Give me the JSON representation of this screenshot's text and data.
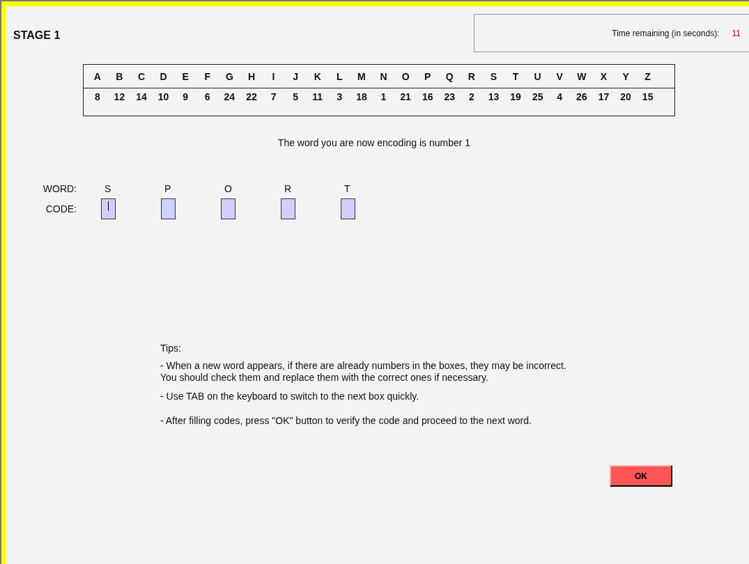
{
  "title": "STAGE 1",
  "timer": {
    "label": "Time remaining (in seconds):",
    "value": "11"
  },
  "key_table": {
    "letters": [
      "A",
      "B",
      "C",
      "D",
      "E",
      "F",
      "G",
      "H",
      "I",
      "J",
      "K",
      "L",
      "M",
      "N",
      "O",
      "P",
      "Q",
      "R",
      "S",
      "T",
      "U",
      "V",
      "W",
      "X",
      "Y",
      "Z"
    ],
    "codes": [
      "8",
      "12",
      "14",
      "10",
      "9",
      "6",
      "24",
      "22",
      "7",
      "5",
      "11",
      "3",
      "18",
      "1",
      "21",
      "16",
      "23",
      "2",
      "13",
      "19",
      "25",
      "4",
      "26",
      "17",
      "20",
      "15"
    ]
  },
  "status": "The word you are now encoding is number 1",
  "word_label": "WORD:",
  "code_label": "CODE:",
  "letters": [
    {
      "letter": "S",
      "focused": true
    },
    {
      "letter": "P",
      "focused": false
    },
    {
      "letter": "O",
      "focused": false
    },
    {
      "letter": "R",
      "focused": false
    },
    {
      "letter": "T",
      "focused": false
    }
  ],
  "tips": {
    "heading": "Tips:",
    "items": [
      "-  When a new word appears, if there are already numbers in the boxes, they may be incorrect. You should check them and replace them with the correct ones if necessary.",
      "-  Use TAB on the keyboard to switch to the next box quickly.",
      "-  After filling codes, press \"OK\" button to verify the code and proceed to the next word."
    ]
  },
  "ok_button": "OK"
}
